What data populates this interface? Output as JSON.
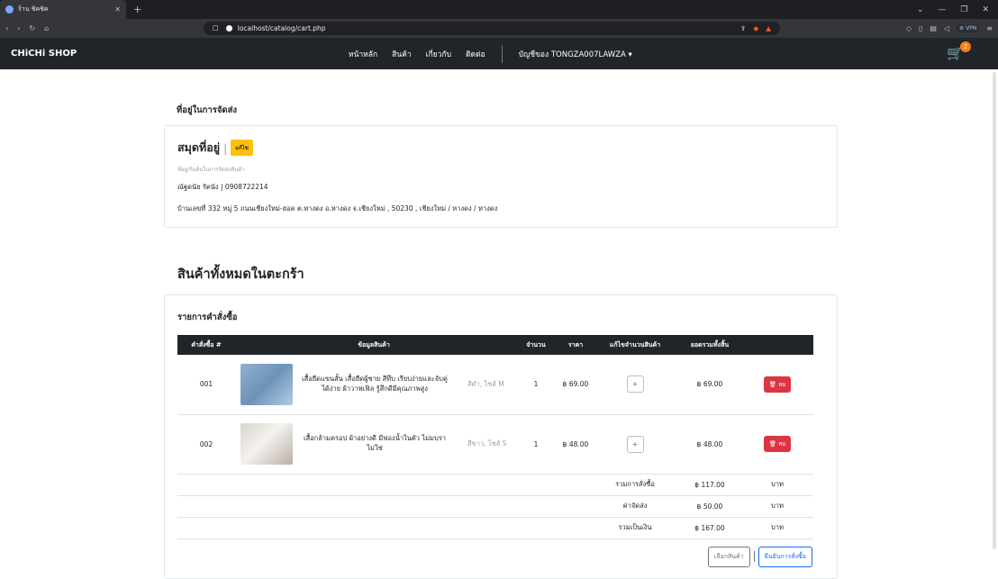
{
  "browser": {
    "tab_title": "ร้าน ชิคชิค",
    "url": "localhost/catalog/cart.php"
  },
  "nav": {
    "brand": "CHiCHi SHOP",
    "items": [
      "หน้าหลัก",
      "สินค้า",
      "เกี่ยวกับ",
      "ติดต่อ"
    ],
    "account": "บัญชีของ TONGZA007LAWZA",
    "cart_count": "2"
  },
  "address": {
    "section_title": "ที่อยู่ในการจัดส่ง",
    "book_title": "สมุดที่อยู่",
    "edit_label": "แก้ไข",
    "hint": "ที่อยู่เริ่มต้นในการจัดส่งสินค้า",
    "name_phone": "ณัฐดนัย รัตนัง | 0908722214",
    "full": "บ้านเลขที่ 332 หมู่ 5 ถนนเชียงใหม่-ฮอด ต.หางดง อ.หางดง จ.เชียงใหม่ , 50230 , เชียงใหม่ / หางดง / หางดง"
  },
  "cart": {
    "title": "สินค้าทั้งหมดในตะกร้า",
    "orders_title": "รายการคำสั่งซื้อ",
    "headers": [
      "คำสั่งซื้อ #",
      "ข้อมูลสินค้า",
      "จำนวน",
      "ราคา",
      "แก้ไขจำนวนสินค้า",
      "ยอดรวมทั้งสิ้น"
    ],
    "rows": [
      {
        "id": "001",
        "name": "เสื้อยืดแขนสั้น เสื้อยืดผู้ชาย สีทึบ เรียบง่ายและจับคู่ได้ง่าย ผ้าวาฟเฟิล รู้สึกดีมีคุณภาพสูง",
        "variant": "สีดำ, ไซส์ M",
        "qty": "1",
        "price": "฿ 69.00",
        "total": "฿ 69.00"
      },
      {
        "id": "002",
        "name": "เสื้อกล้ามครอป ผ้าอย่างดี มีฟองน้ำในตัว ไม่มบราไม่ใช่",
        "variant": "สีขาว, ไซส์ S",
        "qty": "1",
        "price": "฿ 48.00",
        "total": "฿ 48.00"
      }
    ],
    "edit_symbol": "+",
    "delete_label": "ลบ",
    "summary": [
      {
        "label": "รวมการสั่งซื้อ",
        "value": "฿ 117.00",
        "unit": "บาท"
      },
      {
        "label": "ค่าจัดส่ง",
        "value": "฿ 50.00",
        "unit": "บาท"
      },
      {
        "label": "รวมเป็นเงิน",
        "value": "฿ 167.00",
        "unit": "บาท"
      }
    ],
    "buttons": {
      "choose": "เลือกสินค้า",
      "confirm": "ยืนยันการสั่งซื้อ"
    }
  }
}
